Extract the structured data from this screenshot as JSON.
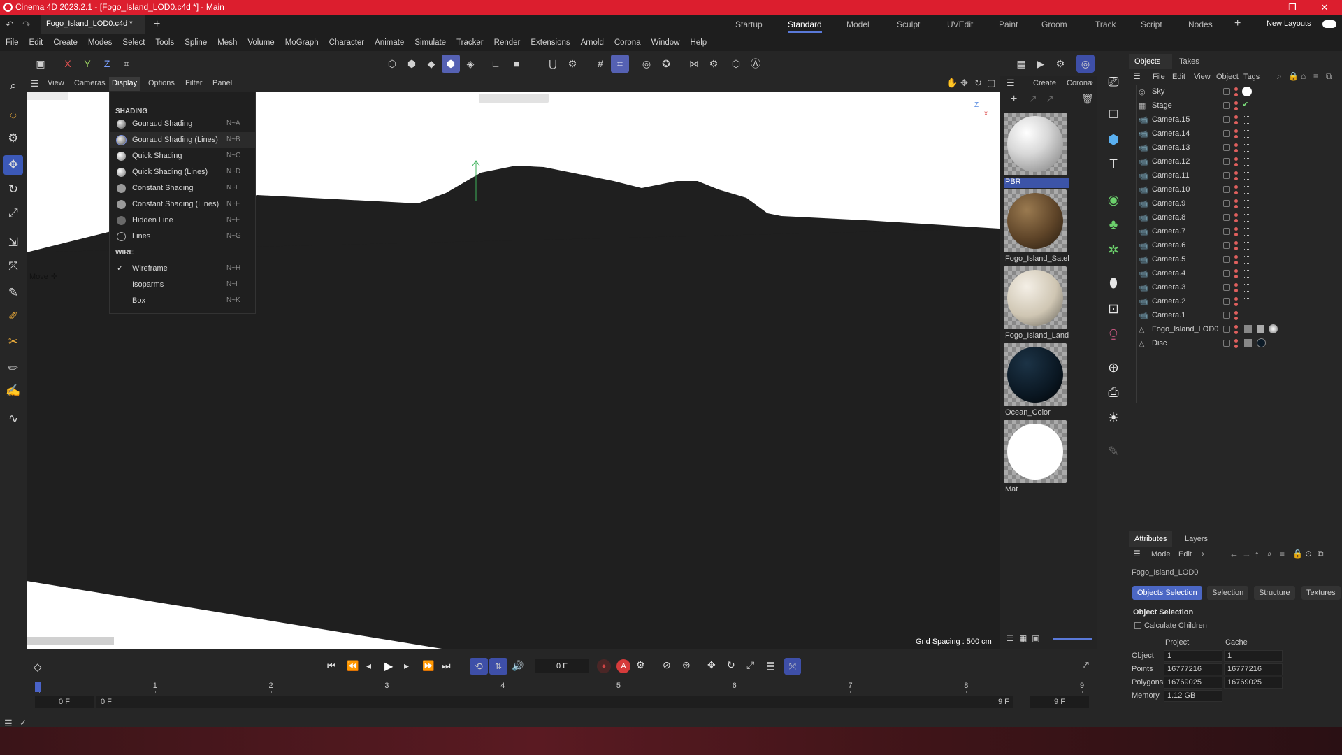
{
  "title": "Cinema 4D 2023.2.1 - [Fogo_Island_LOD0.c4d *] - Main",
  "doc_tab": "Fogo_Island_LOD0.c4d *",
  "layouts": [
    "Startup",
    "Standard",
    "Model",
    "Sculpt",
    "UVEdit",
    "Paint",
    "Groom",
    "Track",
    "Script",
    "Nodes"
  ],
  "new_layouts": "New Layouts",
  "menu": [
    "File",
    "Edit",
    "Create",
    "Modes",
    "Select",
    "Tools",
    "Spline",
    "Mesh",
    "Volume",
    "MoGraph",
    "Character",
    "Animate",
    "Simulate",
    "Tracker",
    "Render",
    "Extensions",
    "Arnold",
    "Corona",
    "Window",
    "Help"
  ],
  "axes": {
    "x": "X",
    "y": "Y",
    "z": "Z"
  },
  "viewport_menu": [
    "View",
    "Cameras",
    "Display",
    "Options",
    "Filter",
    "Panel"
  ],
  "display_menu": {
    "shading_header": "SHADING",
    "shading": [
      {
        "label": "Gouraud Shading",
        "shortcut": "N~A"
      },
      {
        "label": "Gouraud Shading (Lines)",
        "shortcut": "N~B"
      },
      {
        "label": "Quick Shading",
        "shortcut": "N~C"
      },
      {
        "label": "Quick Shading (Lines)",
        "shortcut": "N~D"
      },
      {
        "label": "Constant Shading",
        "shortcut": "N~E"
      },
      {
        "label": "Constant Shading (Lines)",
        "shortcut": "N~F"
      },
      {
        "label": "Hidden Line",
        "shortcut": "N~F"
      },
      {
        "label": "Lines",
        "shortcut": "N~G"
      }
    ],
    "wire_header": "WIRE",
    "wire": [
      {
        "label": "Wireframe",
        "shortcut": "N~H",
        "checked": true
      },
      {
        "label": "Isoparms",
        "shortcut": "N~I"
      },
      {
        "label": "Box",
        "shortcut": "N~K"
      }
    ]
  },
  "move_label": "Move",
  "grid_spacing": "Grid Spacing : 500 cm",
  "material_menu": [
    "Create",
    "Corona"
  ],
  "materials": [
    {
      "name": "PBR",
      "color": "#e8e8e8",
      "selected": true
    },
    {
      "name": "Fogo_Island_Satel",
      "color": "#6b5236"
    },
    {
      "name": "Fogo_Island_Land",
      "color": "#d8d3c6"
    },
    {
      "name": "Ocean_Color",
      "color": "#0c1a26"
    },
    {
      "name": "Mat",
      "color": "#ffffff"
    }
  ],
  "obj_tabs": [
    "Objects",
    "Takes"
  ],
  "obj_menu": [
    "File",
    "Edit",
    "View",
    "Object",
    "Tags"
  ],
  "objects": [
    "Sky",
    "Stage",
    "Camera.15",
    "Camera.14",
    "Camera.13",
    "Camera.12",
    "Camera.11",
    "Camera.10",
    "Camera.9",
    "Camera.8",
    "Camera.7",
    "Camera.6",
    "Camera.5",
    "Camera.4",
    "Camera.3",
    "Camera.2",
    "Camera.1",
    "Fogo_Island_LOD0",
    "Disc"
  ],
  "attr_tabs": [
    "Attributes",
    "Layers"
  ],
  "attr_menu": [
    "Mode",
    "Edit"
  ],
  "attr_object": "Fogo_Island_LOD0",
  "attr_buttons": [
    "Objects Selection",
    "Selection",
    "Structure",
    "Textures"
  ],
  "attr_section": "Object Selection",
  "calc_children": "Calculate Children",
  "col_project": "Project",
  "col_cache": "Cache",
  "stats": [
    {
      "label": "Object",
      "project": "1",
      "cache": "1"
    },
    {
      "label": "Points",
      "project": "16777216",
      "cache": "16777216"
    },
    {
      "label": "Polygons",
      "project": "16769025",
      "cache": "16769025"
    },
    {
      "label": "Memory",
      "project": "1.12 GB",
      "cache": ""
    }
  ],
  "timeline": {
    "frame_field": "0 F",
    "ticks": [
      "0",
      "1",
      "2",
      "3",
      "4",
      "5",
      "6",
      "7",
      "8",
      "9"
    ],
    "start": "0 F",
    "start2": "0 F",
    "end": "9 F",
    "end2": "9 F"
  }
}
